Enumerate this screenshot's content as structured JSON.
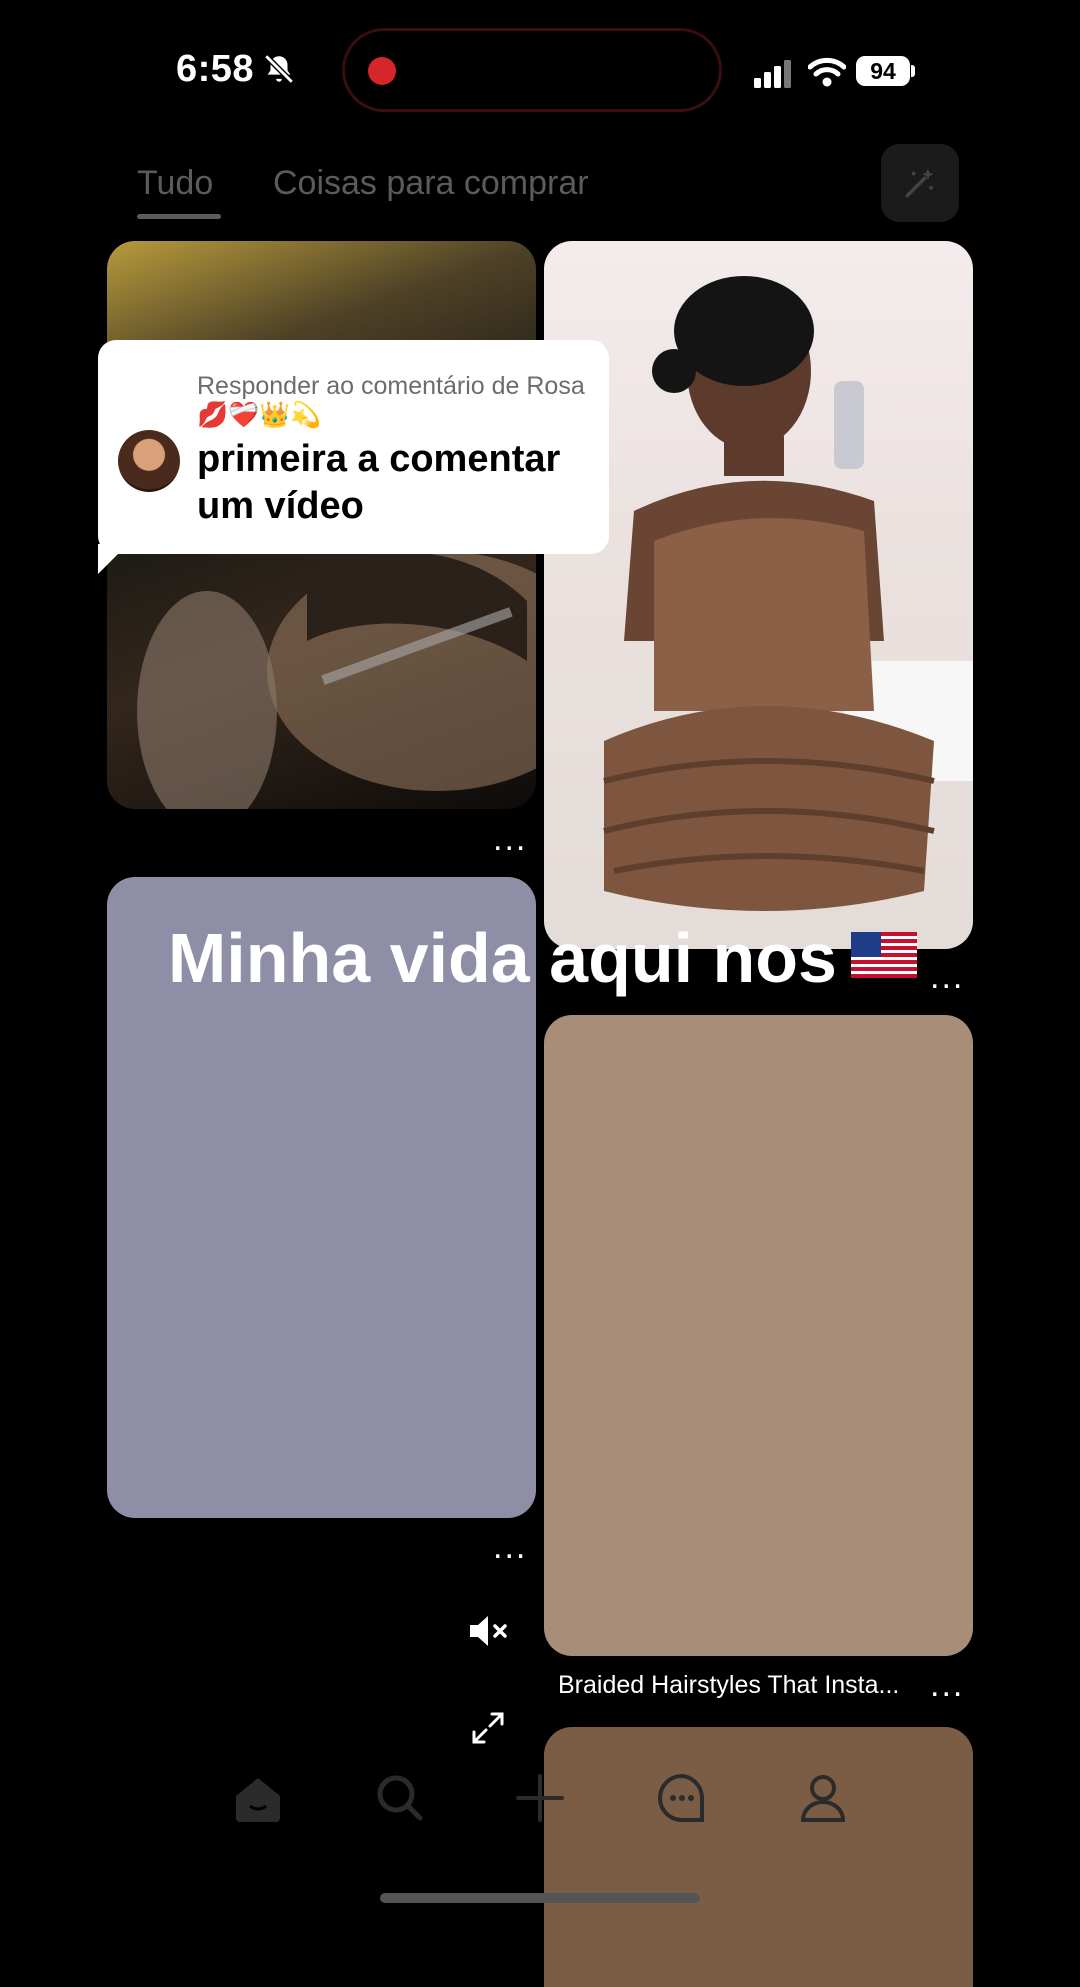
{
  "status_bar": {
    "time": "6:58",
    "battery": "94"
  },
  "tabs": [
    {
      "label": "Tudo",
      "active": true
    },
    {
      "label": "Coisas para comprar",
      "active": false
    }
  ],
  "reply_sticker": {
    "header": "Responder ao comentário de Rosa 💋❤️‍🩹👑💫",
    "text": "primeira a comentar um vídeo"
  },
  "caption": "Minha vida aqui nos",
  "pins": [
    {
      "title": "",
      "more": "..."
    },
    {
      "title": "",
      "more": "..."
    },
    {
      "title": "",
      "more": "..."
    },
    {
      "title": "Braided Hairstyles That Insta...",
      "more": "..."
    }
  ],
  "icons": [
    "bell-slash-icon",
    "signal-icon",
    "wifi-icon",
    "magic-wand-icon",
    "mute-icon",
    "expand-icon",
    "home-icon",
    "search-icon",
    "plus-icon",
    "messages-icon",
    "profile-icon",
    "us-flag-icon"
  ],
  "colors": {
    "recording": "#d7262b",
    "pin_3_bg": "#8e8ea6",
    "pin_4_bg": "#a88d78"
  }
}
